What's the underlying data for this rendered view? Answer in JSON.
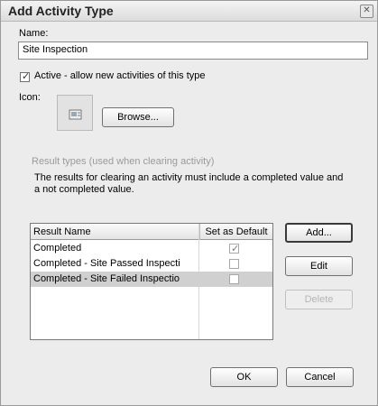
{
  "dialog": {
    "title": "Add Activity Type"
  },
  "name_field": {
    "label": "Name:",
    "value": "Site Inspection"
  },
  "active_checkbox": {
    "checked": true,
    "label": "Active - allow new activities of this type"
  },
  "icon": {
    "label": "Icon:",
    "browse_label": "Browse..."
  },
  "result_types": {
    "section_label": "Result types (used when clearing activity)",
    "info_text": "The results for clearing an activity must include a completed value and a not completed value.",
    "columns": [
      "Result Name",
      "Set as Default"
    ],
    "rows": [
      {
        "name": "Completed",
        "default": true,
        "selected": false
      },
      {
        "name": "Completed - Site Passed Inspecti",
        "default": false,
        "selected": false
      },
      {
        "name": "Completed - Site Failed Inspectio",
        "default": false,
        "selected": true
      }
    ],
    "buttons": {
      "add": "Add...",
      "edit": "Edit",
      "delete": "Delete"
    }
  },
  "footer": {
    "ok": "OK",
    "cancel": "Cancel"
  }
}
